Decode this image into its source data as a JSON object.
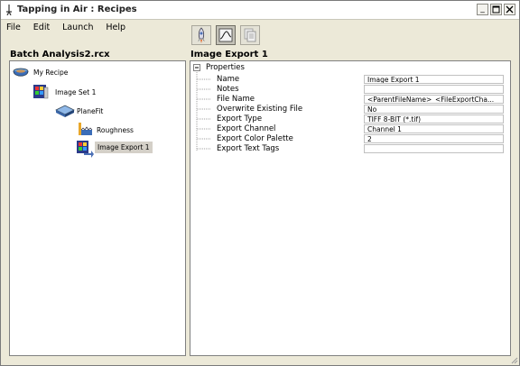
{
  "window": {
    "title": "Tapping in Air : Recipes"
  },
  "menu": [
    "File",
    "Edit",
    "Launch",
    "Help"
  ],
  "toolbar": {
    "icons": [
      "rocket-icon",
      "graph-icon",
      "copy-icon"
    ]
  },
  "left_panel": {
    "title": "Batch Analysis2.rcx",
    "tree": [
      {
        "label": "My Recipe",
        "icon": "recipe-bowl-icon"
      },
      {
        "label": "Image Set 1",
        "icon": "image-set-icon"
      },
      {
        "label": "PlaneFit",
        "icon": "planefit-icon"
      },
      {
        "label": "Roughness",
        "icon": "roughness-icon"
      },
      {
        "label": "Image Export 1",
        "icon": "image-export-icon",
        "selected": true
      }
    ]
  },
  "right_panel": {
    "title": "Image Export 1",
    "group": "Properties",
    "properties": [
      {
        "name": "Name",
        "value": "Image Export 1"
      },
      {
        "name": "Notes",
        "value": ""
      },
      {
        "name": "File Name",
        "value": "<ParentFileName>_<FileExportCha..."
      },
      {
        "name": "Overwrite Existing File",
        "value": "No"
      },
      {
        "name": "Export Type",
        "value": "TIFF 8-BIT (*.tif)"
      },
      {
        "name": "Export Channel",
        "value": "Channel 1"
      },
      {
        "name": "Export Color Palette",
        "value": "2"
      },
      {
        "name": "Export Text Tags",
        "value": ""
      }
    ]
  }
}
